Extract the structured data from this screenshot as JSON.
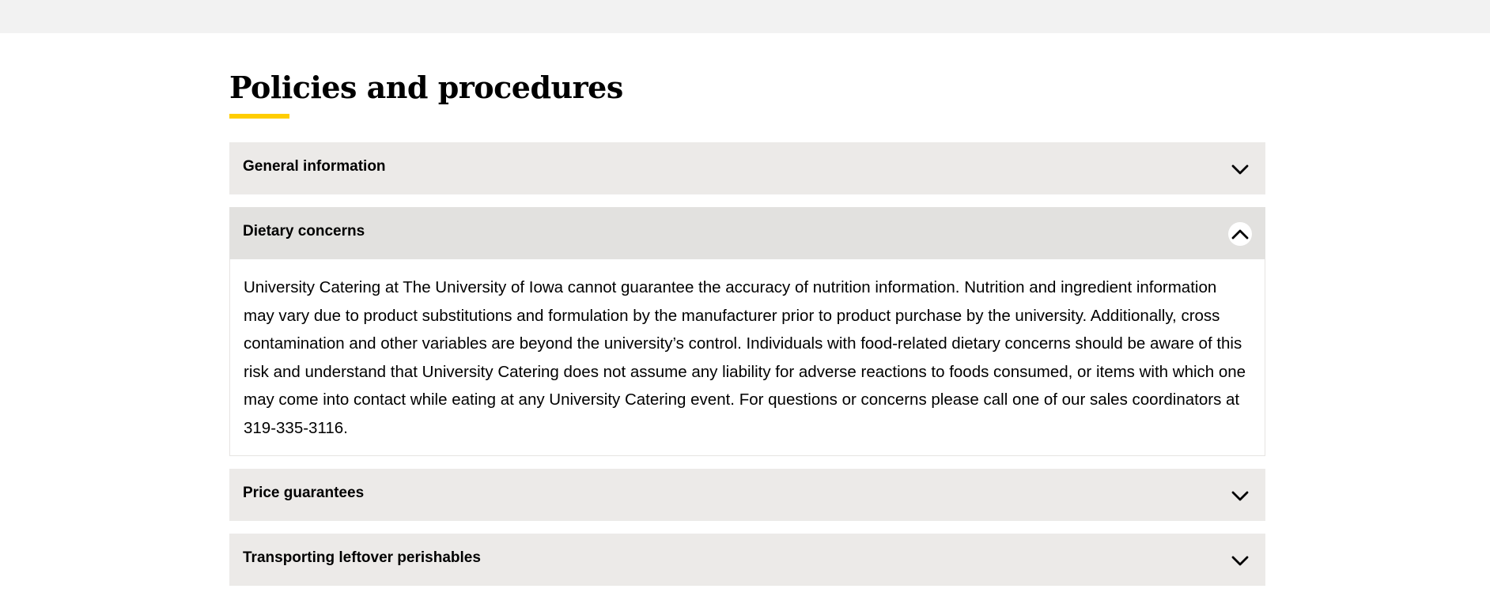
{
  "page": {
    "title": "Policies and procedures",
    "accent_color": "#ffcd00"
  },
  "accordion": {
    "items": [
      {
        "label": "General information",
        "expanded": false,
        "icon": "chevron-down-icon"
      },
      {
        "label": "Dietary concerns",
        "expanded": true,
        "icon": "chevron-up-icon",
        "body": "University Catering at The University of Iowa cannot guarantee the accuracy of nutrition information. Nutrition and ingredient information may vary due to product substitutions and formulation by the manufacturer prior to product purchase by the university. Additionally, cross contamination and other variables are beyond the university’s control. Individuals with food-related dietary concerns should be aware of this risk and understand that University Catering does not assume any liability for adverse reactions to foods consumed, or items with which one may come into contact while eating at any University Catering event. For questions or concerns please call one of our sales coordinators at 319-335-3116."
      },
      {
        "label": "Price guarantees",
        "expanded": false,
        "icon": "chevron-down-icon"
      },
      {
        "label": "Transporting leftover perishables",
        "expanded": false,
        "icon": "chevron-down-icon"
      }
    ]
  }
}
